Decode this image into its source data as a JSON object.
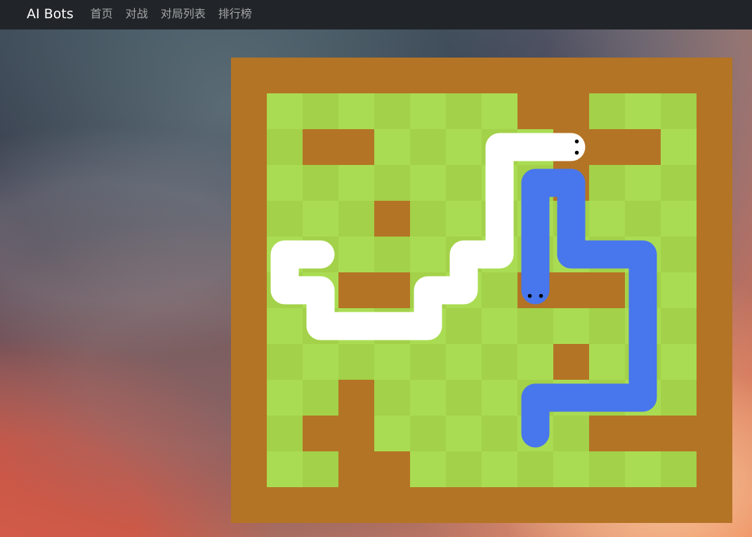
{
  "navbar": {
    "brand": "AI Bots",
    "items": [
      {
        "label": "首页"
      },
      {
        "label": "对战"
      },
      {
        "label": "对局列表"
      },
      {
        "label": "排行榜"
      }
    ]
  },
  "board": {
    "rows": 13,
    "cols": 14,
    "colors": {
      "background": "#B47425",
      "cell_light": "#AADC53",
      "cell_dark": "#A3D149",
      "wall": "#B47425",
      "snake_white": "#FFFFFF",
      "snake_blue": "#4876EC",
      "eye": "#000000"
    },
    "walls": [
      [
        0,
        0
      ],
      [
        0,
        1
      ],
      [
        0,
        2
      ],
      [
        0,
        3
      ],
      [
        0,
        4
      ],
      [
        0,
        5
      ],
      [
        0,
        6
      ],
      [
        0,
        7
      ],
      [
        0,
        8
      ],
      [
        0,
        9
      ],
      [
        0,
        10
      ],
      [
        0,
        11
      ],
      [
        0,
        12
      ],
      [
        0,
        13
      ],
      [
        12,
        0
      ],
      [
        12,
        1
      ],
      [
        12,
        2
      ],
      [
        12,
        3
      ],
      [
        12,
        4
      ],
      [
        12,
        5
      ],
      [
        12,
        6
      ],
      [
        12,
        7
      ],
      [
        12,
        8
      ],
      [
        12,
        9
      ],
      [
        12,
        10
      ],
      [
        12,
        11
      ],
      [
        12,
        12
      ],
      [
        12,
        13
      ],
      [
        1,
        0
      ],
      [
        2,
        0
      ],
      [
        3,
        0
      ],
      [
        4,
        0
      ],
      [
        5,
        0
      ],
      [
        6,
        0
      ],
      [
        7,
        0
      ],
      [
        8,
        0
      ],
      [
        9,
        0
      ],
      [
        10,
        0
      ],
      [
        11,
        0
      ],
      [
        1,
        13
      ],
      [
        2,
        13
      ],
      [
        3,
        13
      ],
      [
        4,
        13
      ],
      [
        5,
        13
      ],
      [
        6,
        13
      ],
      [
        7,
        13
      ],
      [
        8,
        13
      ],
      [
        9,
        13
      ],
      [
        10,
        13
      ],
      [
        11,
        13
      ],
      [
        1,
        8
      ],
      [
        1,
        9
      ],
      [
        2,
        2
      ],
      [
        2,
        3
      ],
      [
        2,
        9
      ],
      [
        2,
        10
      ],
      [
        2,
        11
      ],
      [
        3,
        9
      ],
      [
        4,
        4
      ],
      [
        6,
        3
      ],
      [
        6,
        4
      ],
      [
        6,
        8
      ],
      [
        6,
        9
      ],
      [
        6,
        10
      ],
      [
        8,
        9
      ],
      [
        9,
        3
      ],
      [
        10,
        2
      ],
      [
        10,
        3
      ],
      [
        10,
        10
      ],
      [
        10,
        11
      ],
      [
        10,
        12
      ],
      [
        11,
        3
      ],
      [
        11,
        4
      ]
    ],
    "snakes": [
      {
        "id": "white",
        "color_key": "snake_white",
        "path": [
          [
            2,
            9
          ],
          [
            2,
            8
          ],
          [
            2,
            7
          ],
          [
            3,
            7
          ],
          [
            4,
            7
          ],
          [
            5,
            7
          ],
          [
            5,
            6
          ],
          [
            6,
            6
          ],
          [
            6,
            5
          ],
          [
            7,
            5
          ],
          [
            7,
            4
          ],
          [
            7,
            3
          ],
          [
            7,
            2
          ],
          [
            6,
            2
          ],
          [
            6,
            1
          ],
          [
            5,
            1
          ],
          [
            5,
            2
          ]
        ],
        "eyes": "right"
      },
      {
        "id": "blue",
        "color_key": "snake_blue",
        "path": [
          [
            6,
            8
          ],
          [
            5,
            8
          ],
          [
            4,
            8
          ],
          [
            3,
            8
          ],
          [
            3,
            9
          ],
          [
            4,
            9
          ],
          [
            5,
            9
          ],
          [
            5,
            10
          ],
          [
            5,
            11
          ],
          [
            6,
            11
          ],
          [
            7,
            11
          ],
          [
            8,
            11
          ],
          [
            9,
            11
          ],
          [
            9,
            10
          ],
          [
            9,
            9
          ],
          [
            9,
            8
          ],
          [
            10,
            8
          ]
        ],
        "eyes": "down"
      }
    ]
  }
}
